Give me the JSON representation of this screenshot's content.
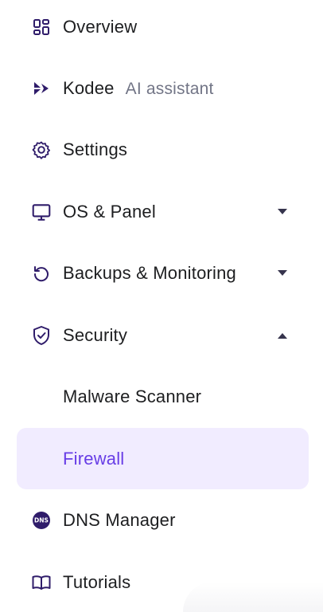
{
  "nav": {
    "overview": {
      "label": "Overview",
      "icon": "dashboard-grid-icon"
    },
    "kodee": {
      "label": "Kodee",
      "sublabel": "AI assistant",
      "icon": "kodee-icon"
    },
    "settings": {
      "label": "Settings",
      "icon": "gear-icon"
    },
    "os_panel": {
      "label": "OS & Panel",
      "icon": "monitor-icon",
      "expanded": false
    },
    "backups": {
      "label": "Backups & Monitoring",
      "icon": "restore-icon",
      "expanded": false
    },
    "security": {
      "label": "Security",
      "icon": "shield-check-icon",
      "expanded": true,
      "children": [
        {
          "label": "Malware Scanner",
          "active": false
        },
        {
          "label": "Firewall",
          "active": true
        }
      ]
    },
    "dns": {
      "label": "DNS Manager",
      "icon": "dns-icon",
      "icon_text": "DNS"
    },
    "tutorials": {
      "label": "Tutorials",
      "icon": "book-icon"
    }
  },
  "colors": {
    "text": "#1d1e20",
    "muted": "#727586",
    "icon": "#2f1c6a",
    "accent": "#673de6",
    "active_bg": "#f1ecff"
  }
}
